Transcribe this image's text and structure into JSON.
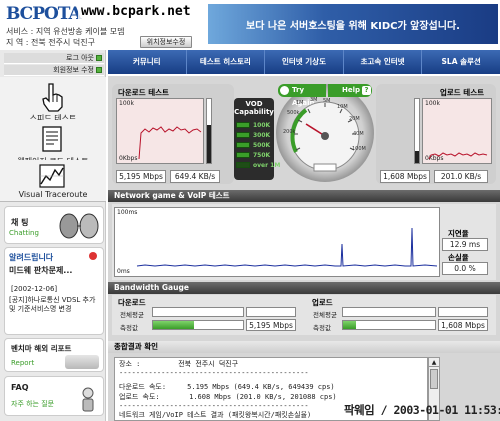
{
  "header": {
    "logo": "BCPOTA",
    "url": "www.bcpark.net",
    "service_line": "서비스 : 지역 유선방송 케이블 모뎀",
    "region_line": "지  역 : 전북 전주시 덕진구",
    "location_button": "위치정보수정",
    "banner_text": "보다 나은 서버호스팅을 위해 KIDC가 앞장섭니다."
  },
  "sidebar": {
    "login_links": [
      "로그 아웃",
      "회원정보 수정"
    ],
    "nav": [
      {
        "label": "스피드 테스트",
        "icon": "speed-hand-icon"
      },
      {
        "label": "웹페이지 로드 테스트",
        "icon": "document-icon"
      },
      {
        "label": "Visual Traceroute",
        "icon": "traceroute-chart-icon"
      }
    ],
    "chat_title": "채 팅",
    "chat_sub": "Chatting",
    "notice_title": "알려드립니다",
    "notice_headline": "미드웨 판차문제...",
    "notice_date": "[2002-12-06]",
    "notice_body": "[공지]하나로통신 VDSL 추가 및 기준서비스명 변경",
    "report_title": "벤치마 해외 리포트",
    "report_sub": "Report",
    "faq_title": "FAQ",
    "faq_sub": "자주 하는 질문"
  },
  "topnav": [
    "커뮤니티",
    "테스트 히스토리",
    "인터넷 기상도",
    "초고속 인터넷",
    "SLA 솔루션"
  ],
  "speed": {
    "download_title": "다운로드 테스트",
    "upload_title": "업로드 테스트",
    "graph_top": "100k",
    "graph_bottom": "0Kbps",
    "download_mbps": "5,195 Mbps",
    "download_kbs": "649.4 KB/s",
    "upload_mbps": "1,608 Mbps",
    "upload_kbs": "201.0 KB/s",
    "vod_title": "VOD Capability",
    "vod_levels": [
      "100K",
      "300K",
      "500K",
      "750K",
      "over 1M"
    ],
    "try_again": "Try Again",
    "help": "Help",
    "dial_labels": [
      "200k",
      "500k",
      "1M",
      "3M",
      "5M",
      "10M",
      "20M",
      "40M",
      "100M"
    ],
    "colors": {
      "accent_green": "#3a9d29",
      "nav_blue": "#1d4f9c",
      "graph_line_red": "#b8122a"
    }
  },
  "voip": {
    "title": "Network game & VoIP 테스트",
    "y_top": "100ms",
    "y_bottom": "0ms",
    "latency_label": "지연율",
    "latency_value": "12.9 ms",
    "loss_label": "손실율",
    "loss_value": "0.0 %"
  },
  "bandwidth": {
    "title": "Bandwidth Gauge",
    "download_label": "다운로드",
    "upload_label": "업로드",
    "row1": "전체평균",
    "row2": "측정값",
    "download_value": "5,195 Mbps",
    "upload_value": "1,608 Mbps",
    "download_fill": 0.45,
    "upload_fill": 0.14
  },
  "summary": {
    "title": "종합결과 확인",
    "lines": [
      "장소 :         전북 전주시 덕진구",
      "---------------------------------------------",
      "다운로드 속도:     5.195 Mbps (649.4 KB/s, 649439 cps)",
      "업로드 속도:       1.608 Mbps (201.0 KB/s, 201088 cps)",
      "---------------------------------------------",
      "네트워크 게임/VoIP 테스트 결과 (패킷왕복시간/패킷손실율)"
    ]
  },
  "watermark": "팍웨임 / 2003-01-01 11:53:05"
}
